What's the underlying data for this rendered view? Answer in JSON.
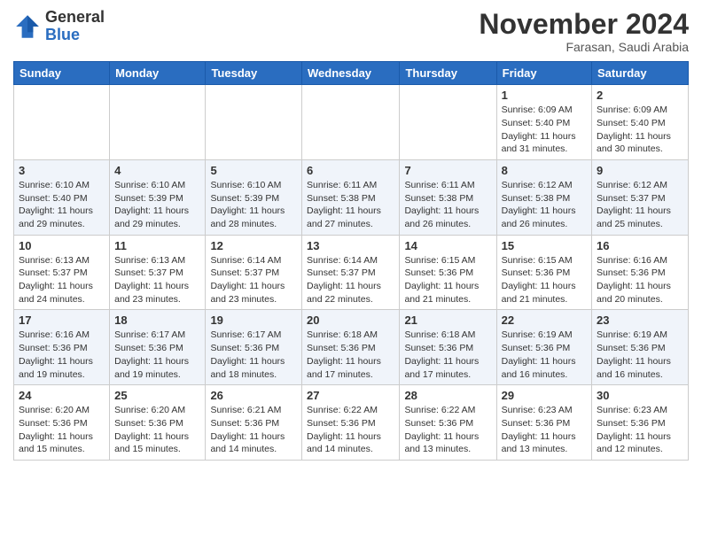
{
  "header": {
    "logo_general": "General",
    "logo_blue": "Blue",
    "month_title": "November 2024",
    "location": "Farasan, Saudi Arabia"
  },
  "weekdays": [
    "Sunday",
    "Monday",
    "Tuesday",
    "Wednesday",
    "Thursday",
    "Friday",
    "Saturday"
  ],
  "weeks": [
    [
      {
        "day": "",
        "sunrise": "",
        "sunset": "",
        "daylight": ""
      },
      {
        "day": "",
        "sunrise": "",
        "sunset": "",
        "daylight": ""
      },
      {
        "day": "",
        "sunrise": "",
        "sunset": "",
        "daylight": ""
      },
      {
        "day": "",
        "sunrise": "",
        "sunset": "",
        "daylight": ""
      },
      {
        "day": "",
        "sunrise": "",
        "sunset": "",
        "daylight": ""
      },
      {
        "day": "1",
        "sunrise": "Sunrise: 6:09 AM",
        "sunset": "Sunset: 5:40 PM",
        "daylight": "Daylight: 11 hours and 31 minutes."
      },
      {
        "day": "2",
        "sunrise": "Sunrise: 6:09 AM",
        "sunset": "Sunset: 5:40 PM",
        "daylight": "Daylight: 11 hours and 30 minutes."
      }
    ],
    [
      {
        "day": "3",
        "sunrise": "Sunrise: 6:10 AM",
        "sunset": "Sunset: 5:40 PM",
        "daylight": "Daylight: 11 hours and 29 minutes."
      },
      {
        "day": "4",
        "sunrise": "Sunrise: 6:10 AM",
        "sunset": "Sunset: 5:39 PM",
        "daylight": "Daylight: 11 hours and 29 minutes."
      },
      {
        "day": "5",
        "sunrise": "Sunrise: 6:10 AM",
        "sunset": "Sunset: 5:39 PM",
        "daylight": "Daylight: 11 hours and 28 minutes."
      },
      {
        "day": "6",
        "sunrise": "Sunrise: 6:11 AM",
        "sunset": "Sunset: 5:38 PM",
        "daylight": "Daylight: 11 hours and 27 minutes."
      },
      {
        "day": "7",
        "sunrise": "Sunrise: 6:11 AM",
        "sunset": "Sunset: 5:38 PM",
        "daylight": "Daylight: 11 hours and 26 minutes."
      },
      {
        "day": "8",
        "sunrise": "Sunrise: 6:12 AM",
        "sunset": "Sunset: 5:38 PM",
        "daylight": "Daylight: 11 hours and 26 minutes."
      },
      {
        "day": "9",
        "sunrise": "Sunrise: 6:12 AM",
        "sunset": "Sunset: 5:37 PM",
        "daylight": "Daylight: 11 hours and 25 minutes."
      }
    ],
    [
      {
        "day": "10",
        "sunrise": "Sunrise: 6:13 AM",
        "sunset": "Sunset: 5:37 PM",
        "daylight": "Daylight: 11 hours and 24 minutes."
      },
      {
        "day": "11",
        "sunrise": "Sunrise: 6:13 AM",
        "sunset": "Sunset: 5:37 PM",
        "daylight": "Daylight: 11 hours and 23 minutes."
      },
      {
        "day": "12",
        "sunrise": "Sunrise: 6:14 AM",
        "sunset": "Sunset: 5:37 PM",
        "daylight": "Daylight: 11 hours and 23 minutes."
      },
      {
        "day": "13",
        "sunrise": "Sunrise: 6:14 AM",
        "sunset": "Sunset: 5:37 PM",
        "daylight": "Daylight: 11 hours and 22 minutes."
      },
      {
        "day": "14",
        "sunrise": "Sunrise: 6:15 AM",
        "sunset": "Sunset: 5:36 PM",
        "daylight": "Daylight: 11 hours and 21 minutes."
      },
      {
        "day": "15",
        "sunrise": "Sunrise: 6:15 AM",
        "sunset": "Sunset: 5:36 PM",
        "daylight": "Daylight: 11 hours and 21 minutes."
      },
      {
        "day": "16",
        "sunrise": "Sunrise: 6:16 AM",
        "sunset": "Sunset: 5:36 PM",
        "daylight": "Daylight: 11 hours and 20 minutes."
      }
    ],
    [
      {
        "day": "17",
        "sunrise": "Sunrise: 6:16 AM",
        "sunset": "Sunset: 5:36 PM",
        "daylight": "Daylight: 11 hours and 19 minutes."
      },
      {
        "day": "18",
        "sunrise": "Sunrise: 6:17 AM",
        "sunset": "Sunset: 5:36 PM",
        "daylight": "Daylight: 11 hours and 19 minutes."
      },
      {
        "day": "19",
        "sunrise": "Sunrise: 6:17 AM",
        "sunset": "Sunset: 5:36 PM",
        "daylight": "Daylight: 11 hours and 18 minutes."
      },
      {
        "day": "20",
        "sunrise": "Sunrise: 6:18 AM",
        "sunset": "Sunset: 5:36 PM",
        "daylight": "Daylight: 11 hours and 17 minutes."
      },
      {
        "day": "21",
        "sunrise": "Sunrise: 6:18 AM",
        "sunset": "Sunset: 5:36 PM",
        "daylight": "Daylight: 11 hours and 17 minutes."
      },
      {
        "day": "22",
        "sunrise": "Sunrise: 6:19 AM",
        "sunset": "Sunset: 5:36 PM",
        "daylight": "Daylight: 11 hours and 16 minutes."
      },
      {
        "day": "23",
        "sunrise": "Sunrise: 6:19 AM",
        "sunset": "Sunset: 5:36 PM",
        "daylight": "Daylight: 11 hours and 16 minutes."
      }
    ],
    [
      {
        "day": "24",
        "sunrise": "Sunrise: 6:20 AM",
        "sunset": "Sunset: 5:36 PM",
        "daylight": "Daylight: 11 hours and 15 minutes."
      },
      {
        "day": "25",
        "sunrise": "Sunrise: 6:20 AM",
        "sunset": "Sunset: 5:36 PM",
        "daylight": "Daylight: 11 hours and 15 minutes."
      },
      {
        "day": "26",
        "sunrise": "Sunrise: 6:21 AM",
        "sunset": "Sunset: 5:36 PM",
        "daylight": "Daylight: 11 hours and 14 minutes."
      },
      {
        "day": "27",
        "sunrise": "Sunrise: 6:22 AM",
        "sunset": "Sunset: 5:36 PM",
        "daylight": "Daylight: 11 hours and 14 minutes."
      },
      {
        "day": "28",
        "sunrise": "Sunrise: 6:22 AM",
        "sunset": "Sunset: 5:36 PM",
        "daylight": "Daylight: 11 hours and 13 minutes."
      },
      {
        "day": "29",
        "sunrise": "Sunrise: 6:23 AM",
        "sunset": "Sunset: 5:36 PM",
        "daylight": "Daylight: 11 hours and 13 minutes."
      },
      {
        "day": "30",
        "sunrise": "Sunrise: 6:23 AM",
        "sunset": "Sunset: 5:36 PM",
        "daylight": "Daylight: 11 hours and 12 minutes."
      }
    ]
  ]
}
